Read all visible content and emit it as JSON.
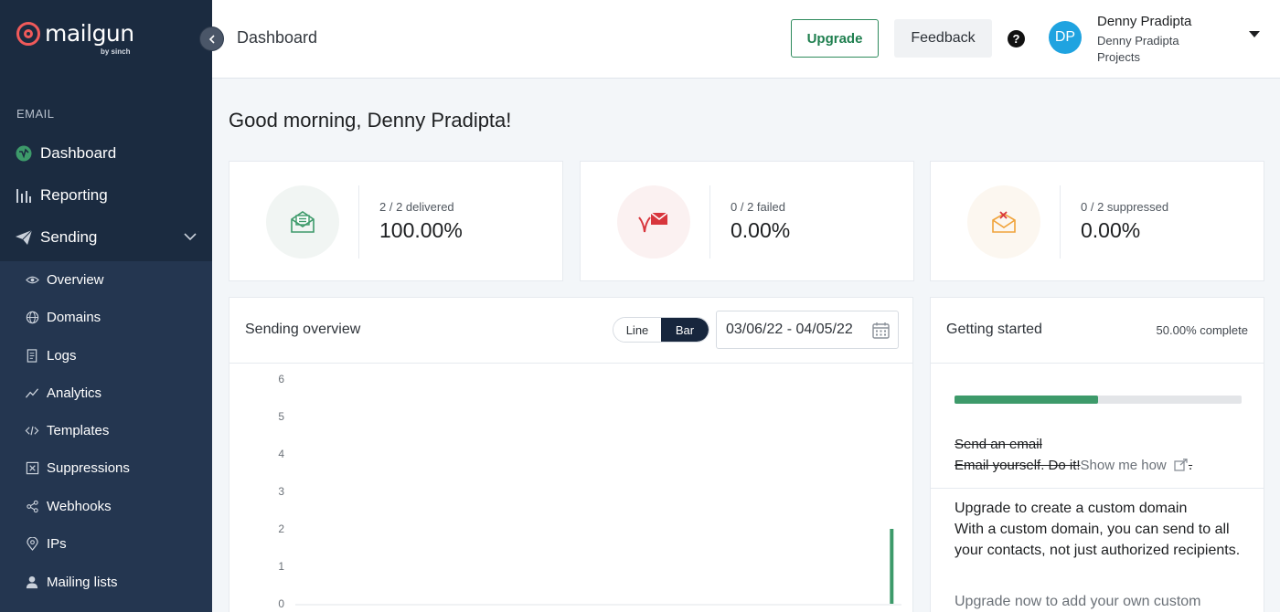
{
  "brand": {
    "name": "mailgun",
    "sub": "by sinch"
  },
  "sidebar": {
    "section": "EMAIL",
    "items": [
      {
        "label": "Dashboard",
        "icon": "dashboard-icon"
      },
      {
        "label": "Reporting",
        "icon": "bar-chart-icon"
      },
      {
        "label": "Sending",
        "icon": "paper-plane-icon"
      }
    ],
    "sub_items": [
      {
        "label": "Overview",
        "icon": "eye-icon"
      },
      {
        "label": "Domains",
        "icon": "globe-icon"
      },
      {
        "label": "Logs",
        "icon": "document-icon"
      },
      {
        "label": "Analytics",
        "icon": "trend-icon"
      },
      {
        "label": "Templates",
        "icon": "code-icon"
      },
      {
        "label": "Suppressions",
        "icon": "x-box-icon"
      },
      {
        "label": "Webhooks",
        "icon": "share-icon"
      },
      {
        "label": "IPs",
        "icon": "pin-icon"
      },
      {
        "label": "Mailing lists",
        "icon": "person-icon"
      }
    ]
  },
  "header": {
    "title": "Dashboard",
    "upgrade_label": "Upgrade",
    "feedback_label": "Feedback",
    "help": "?",
    "avatar_initials": "DP",
    "user_name": "Denny Pradipta",
    "user_projects": "Denny Pradipta Projects"
  },
  "greeting": "Good morning, Denny Pradipta!",
  "stats": [
    {
      "label": "2 / 2 delivered",
      "value": "100.00%",
      "color": "#3d9a6a",
      "bg": "#f1f5f3"
    },
    {
      "label": "0 / 2 failed",
      "value": "0.00%",
      "color": "#d8363d",
      "bg": "#fbf1f1"
    },
    {
      "label": "0 / 2 suppressed",
      "value": "0.00%",
      "color": "#f0a33a",
      "bg": "#fcf7f0"
    }
  ],
  "sending_overview": {
    "title": "Sending overview",
    "toggle": {
      "line": "Line",
      "bar": "Bar",
      "active": "Bar"
    },
    "date_range": "03/06/22 - 04/05/22"
  },
  "chart_data": {
    "type": "bar",
    "y_ticks": [
      "6",
      "5",
      "4",
      "3",
      "2",
      "1",
      "0"
    ],
    "ylim": [
      0,
      6
    ],
    "days": 31,
    "values": [
      0,
      0,
      0,
      0,
      0,
      0,
      0,
      0,
      0,
      0,
      0,
      0,
      0,
      0,
      0,
      0,
      0,
      0,
      0,
      0,
      0,
      0,
      0,
      0,
      0,
      0,
      0,
      0,
      0,
      0,
      2
    ],
    "bar_color": "#3d9a6a"
  },
  "getting_started": {
    "title": "Getting started",
    "complete": "50.00% complete",
    "progress": 0.5,
    "task1": "Send an email",
    "task2": "Email yourself. Do it!",
    "show_me_how": "Show me how",
    "trailing": ".",
    "upgrade_title": "Upgrade to create a custom domain",
    "upgrade_desc": "With a custom domain, you can send to all your contacts, not just authorized recipients.",
    "upgrade_more": "Upgrade now to add your own custom"
  }
}
